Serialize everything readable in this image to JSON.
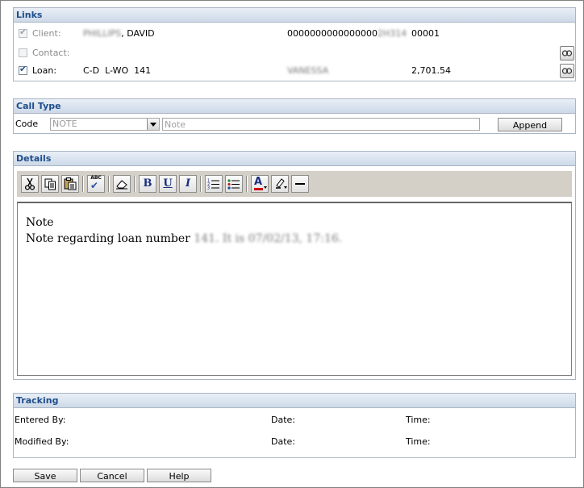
{
  "links": {
    "title": "Links",
    "client": {
      "label": "Client:",
      "checked": true,
      "disabled": true,
      "name_blurred": "PHILLIPS",
      "name_visible": ", DAVID",
      "account_visible": "0000000000000000",
      "account_blurred": "2H314",
      "code": "00001"
    },
    "contact": {
      "label": "Contact:",
      "checked": false,
      "disabled": true
    },
    "loan": {
      "label": "Loan:",
      "checked": true,
      "loan_id": "C-D  L-WO  141",
      "officer_blurred": "VANESSA",
      "amount": "2,701.54"
    },
    "link_icon": "link-chain-icon"
  },
  "call_type": {
    "title": "Call Type",
    "code_label": "Code",
    "code_value": "NOTE",
    "note_placeholder": "Note",
    "append_label": "Append"
  },
  "details": {
    "title": "Details",
    "toolbar": [
      {
        "name": "cut-button",
        "icon": "scissors-icon"
      },
      {
        "name": "copy-button",
        "icon": "copy-icon"
      },
      {
        "name": "paste-button",
        "icon": "paste-icon"
      },
      {
        "name": "spellcheck-button",
        "icon": "spellcheck-icon",
        "label": "ABC"
      },
      {
        "name": "eraser-button",
        "icon": "eraser-icon"
      },
      {
        "name": "bold-button",
        "icon": "bold-icon",
        "label": "B"
      },
      {
        "name": "underline-button",
        "icon": "underline-icon",
        "label": "U"
      },
      {
        "name": "italic-button",
        "icon": "italic-icon",
        "label": "I"
      },
      {
        "name": "ordered-list-button",
        "icon": "ordered-list-icon"
      },
      {
        "name": "bullet-list-button",
        "icon": "bullet-list-icon"
      },
      {
        "name": "font-color-button",
        "icon": "font-color-icon",
        "label": "A"
      },
      {
        "name": "highlight-button",
        "icon": "highlight-icon"
      },
      {
        "name": "horizontal-rule-button",
        "icon": "horizontal-rule-icon"
      }
    ],
    "body_line1": "Note",
    "body_line2_prefix": "Note regarding loan number ",
    "body_line2_blurred": "141. It is 07/02/13, 17:16.",
    "font_color": "#cc0000"
  },
  "tracking": {
    "title": "Tracking",
    "entered_by_label": "Entered By:",
    "modified_by_label": "Modified By:",
    "date_label": "Date:",
    "time_label": "Time:"
  },
  "footer": {
    "save_label": "Save",
    "cancel_label": "Cancel",
    "help_label": "Help"
  }
}
